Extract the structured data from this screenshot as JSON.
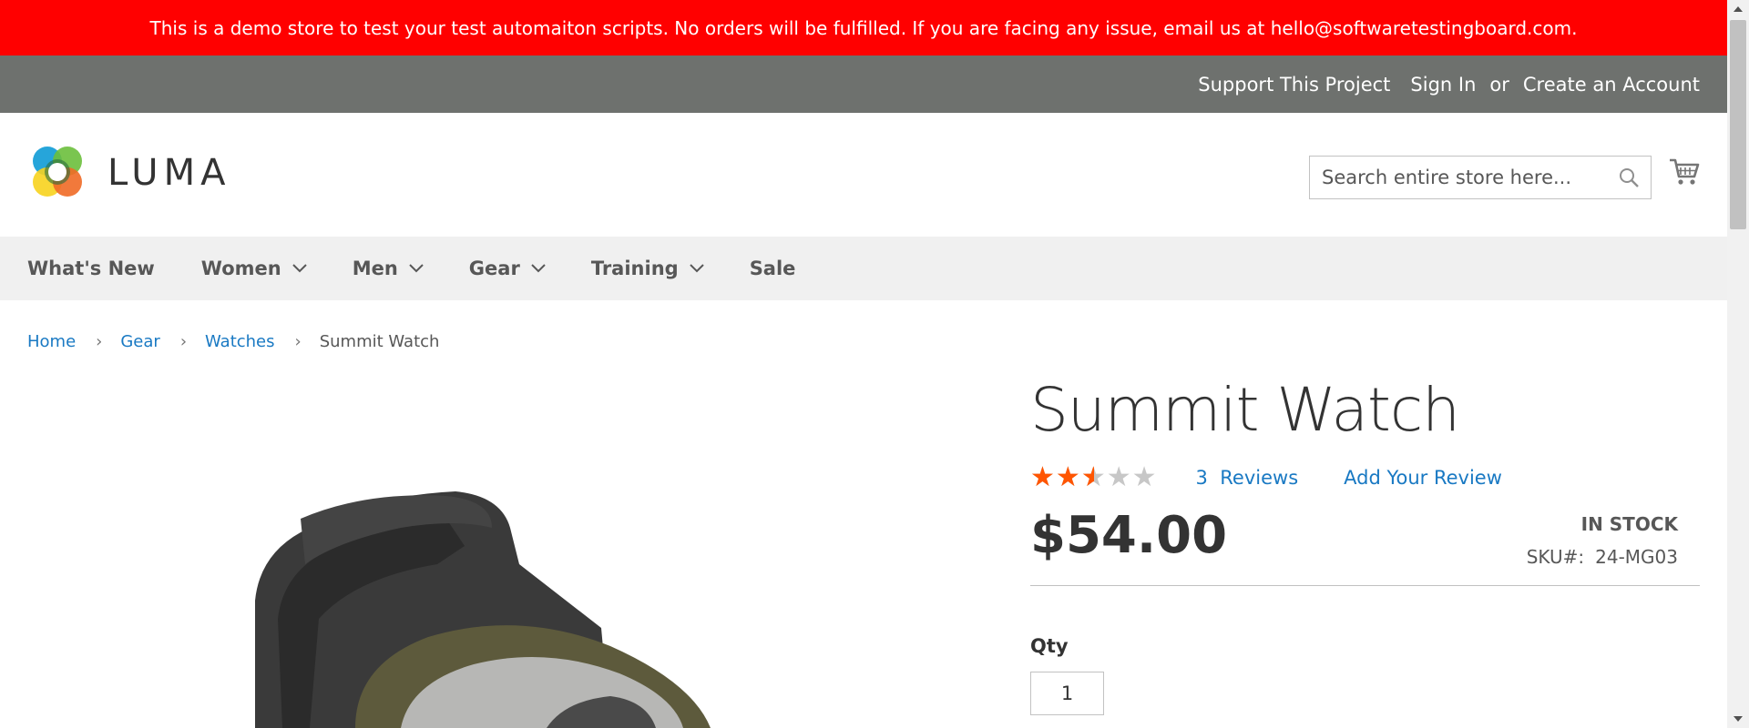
{
  "banner": {
    "text": "This is a demo store to test your test automaiton scripts. No orders will be fulfilled. If you are facing any issue, email us at hello@softwaretestingboard.com.",
    "color": "#ff0000"
  },
  "panel_header": {
    "support": "Support This Project",
    "sign_in": "Sign In",
    "or": "or",
    "create_account": "Create an Account"
  },
  "header": {
    "logo_text": "LUMA",
    "search_placeholder": "Search entire store here...",
    "search_value": "",
    "icons": {
      "search": "search-icon",
      "cart": "shopping-cart-icon"
    }
  },
  "nav": {
    "items": [
      {
        "label": "What's New",
        "has_dropdown": false
      },
      {
        "label": "Women",
        "has_dropdown": true
      },
      {
        "label": "Men",
        "has_dropdown": true
      },
      {
        "label": "Gear",
        "has_dropdown": true
      },
      {
        "label": "Training",
        "has_dropdown": true
      },
      {
        "label": "Sale",
        "has_dropdown": false
      }
    ]
  },
  "breadcrumbs": {
    "items": [
      "Home",
      "Gear",
      "Watches"
    ],
    "current": "Summit Watch"
  },
  "product": {
    "title": "Summit Watch",
    "rating_fraction": 0.5,
    "reviews_count": "3",
    "reviews_label": "Reviews",
    "add_review": "Add Your Review",
    "price": "$54.00",
    "stock": "In stock",
    "sku_label": "SKU#:",
    "sku": "24-MG03",
    "qty_label": "Qty",
    "qty_value": "1"
  },
  "colors": {
    "accent_link": "#1979c3",
    "star": "#ff5501",
    "panel": "#6e716e",
    "nav_bg": "#f0f0f0"
  }
}
